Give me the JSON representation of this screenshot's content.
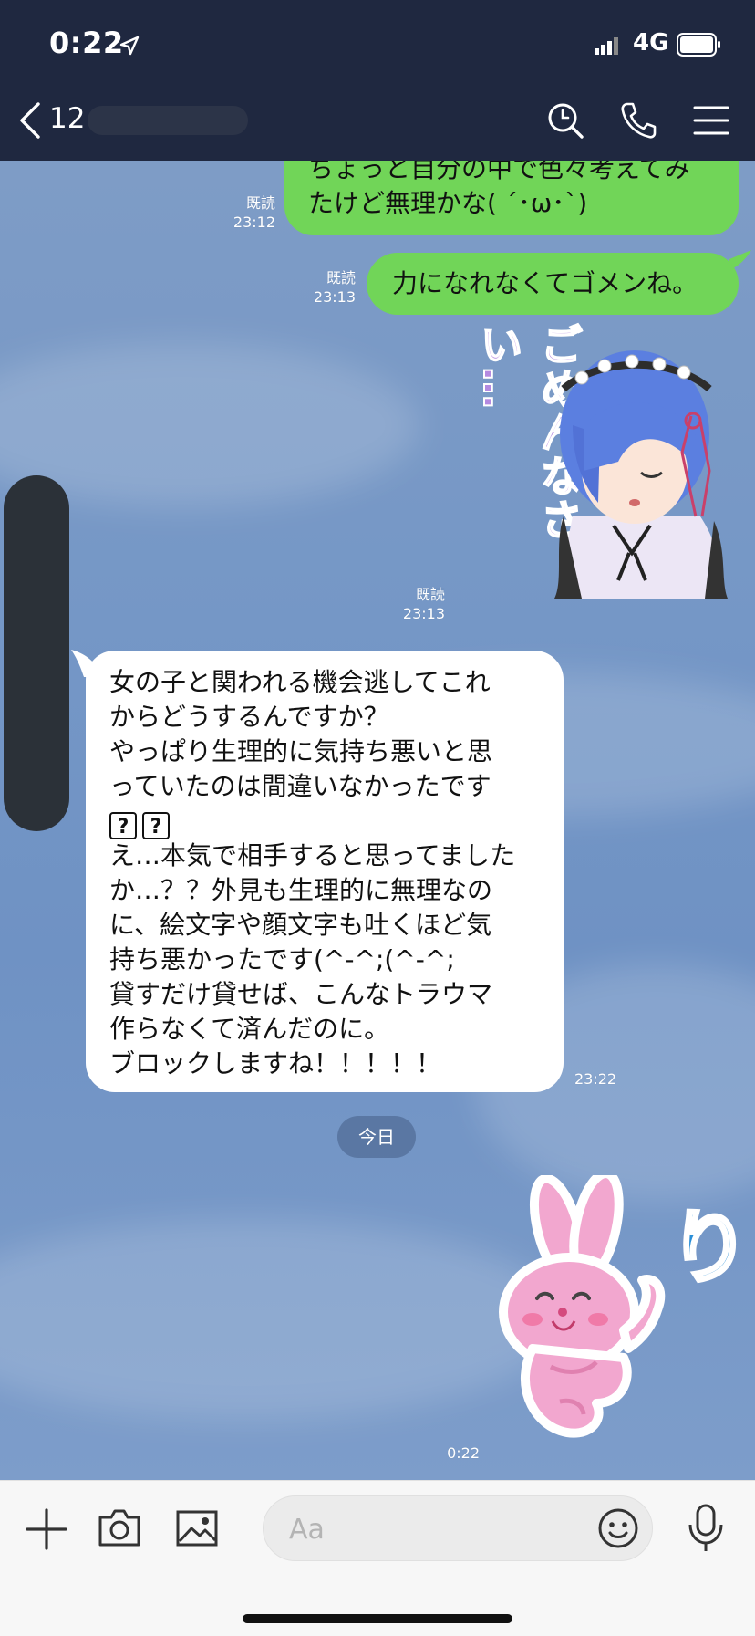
{
  "status_bar": {
    "time": "0:22",
    "network": "4G"
  },
  "header": {
    "back_count": "12"
  },
  "messages": [
    {
      "direction": "out",
      "text": "ちょっと自分の中で色々考えてみ\nたけど無理かな( ´･ω･`)",
      "read": "既読",
      "time": "23:12"
    },
    {
      "direction": "out",
      "text": "力になれなくてゴメンね。",
      "read": "既読",
      "time": "23:13"
    },
    {
      "direction": "out",
      "type": "sticker",
      "sticker_text": "ごめんなさい…",
      "read": "既読",
      "time": "23:13"
    },
    {
      "direction": "in",
      "text_a": "女の子と関われる機会逃してこれ\nからどうするんですか？\nやっぱり生理的に気持ち悪いと思\nっていたのは間違いなかったです",
      "emoji": [
        "?",
        "?"
      ],
      "text_b": "え…本気で相手すると思ってました\nか…？？外見も生理的に無理なの\nに、絵文字や顔文字も吐くほど気\n持ち悪かったです(^-^;(^-^;\n貸すだけ貸せば、こんなトラウマ\n作らなくて済んだのに。\nブロックしますね！！！！！",
      "time": "23:22"
    },
    {
      "direction": "out",
      "type": "sticker",
      "sticker_text": "り",
      "time": "0:22"
    }
  ],
  "date_divider": "今日",
  "composer": {
    "placeholder": "Aa"
  },
  "colors": {
    "header_bg": "#1f2840",
    "outgoing_bubble": "#71d558",
    "incoming_bubble": "#ffffff"
  },
  "icons": [
    "location-arrow-icon",
    "signal-icon",
    "battery-icon",
    "back-chevron-icon",
    "search-icon",
    "phone-icon",
    "menu-icon",
    "plus-icon",
    "camera-icon",
    "image-icon",
    "emoji-icon",
    "microphone-icon"
  ]
}
